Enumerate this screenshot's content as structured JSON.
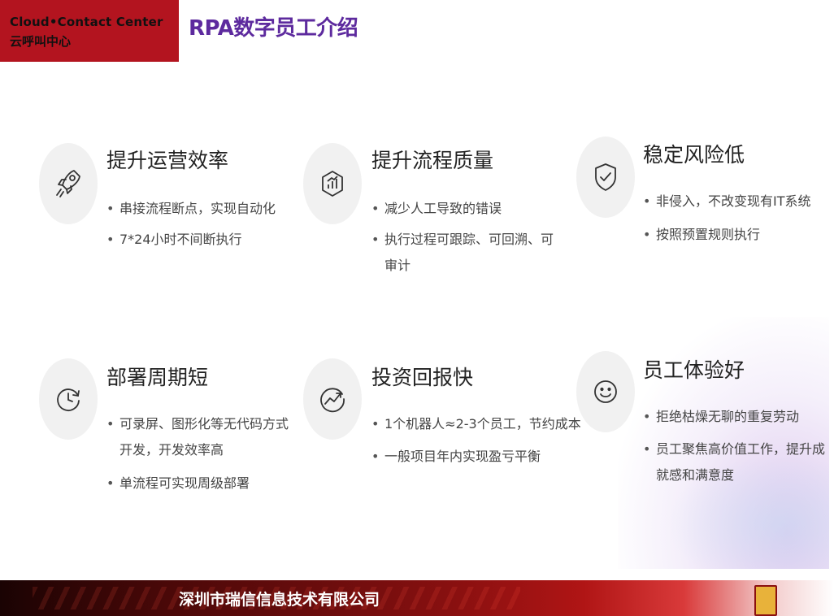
{
  "header": {
    "logo_line1": "Cloud•Contact Center",
    "logo_line2": "云呼叫中心",
    "title": "RPA数字员工介绍"
  },
  "cards": [
    {
      "title": "提升运营效率",
      "icon": "rocket-icon",
      "bullets": [
        "串接流程断点，实现自动化",
        "7*24小时不间断执行"
      ]
    },
    {
      "title": "提升流程质量",
      "icon": "chart-badge-icon",
      "bullets": [
        "减少人工导致的错误",
        "执行过程可跟踪、可回溯、可",
        "审计"
      ]
    },
    {
      "title": "稳定风险低",
      "icon": "shield-check-icon",
      "bullets": [
        "非侵入，不改变现有IT系统",
        "按照预置规则执行"
      ]
    },
    {
      "title": "部署周期短",
      "icon": "clock-icon",
      "bullets": [
        "可录屏、图形化等无代码方式",
        "开发，开发效率高",
        "单流程可实现周级部署"
      ]
    },
    {
      "title": "投资回报快",
      "icon": "trend-up-icon",
      "bullets": [
        "1个机器人≈2-3个员工，节约成本",
        "一般项目年内实现盈亏平衡"
      ]
    },
    {
      "title": "员工体验好",
      "icon": "smile-icon",
      "bullets": [
        "拒绝枯燥无聊的重复劳动",
        "员工聚焦高价值工作，提升成",
        "就感和满意度"
      ]
    }
  ],
  "footer": {
    "company": "深圳市瑞信信息技术有限公司"
  },
  "colors": {
    "logo_bg": "#b3141f",
    "title": "#5d2a9e",
    "footer_red": "#8a1010"
  }
}
